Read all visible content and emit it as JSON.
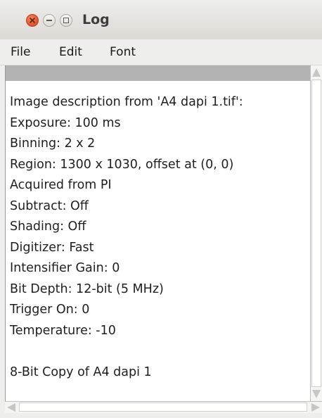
{
  "window": {
    "title": "Log"
  },
  "titlebar": {
    "buttons": [
      "close-icon",
      "minimize-icon",
      "maximize-icon"
    ],
    "close_color": "#e0502a"
  },
  "menubar": {
    "items": [
      {
        "label": "File"
      },
      {
        "label": "Edit"
      },
      {
        "label": "Font"
      }
    ]
  },
  "log": {
    "lines": [
      "Image description from 'A4 dapi 1.tif':",
      "Exposure: 100 ms",
      "Binning: 2 x 2",
      "Region: 1300 x 1030, offset at (0, 0)",
      "Acquired from PI",
      "Subtract: Off",
      "Shading: Off",
      "Digitizer: Fast",
      "Intensifier Gain: 0",
      "Bit Depth: 12-bit (5 MHz)",
      "Trigger On: 0",
      "Temperature: -10",
      "",
      "8-Bit Copy of A4 dapi 1"
    ]
  }
}
